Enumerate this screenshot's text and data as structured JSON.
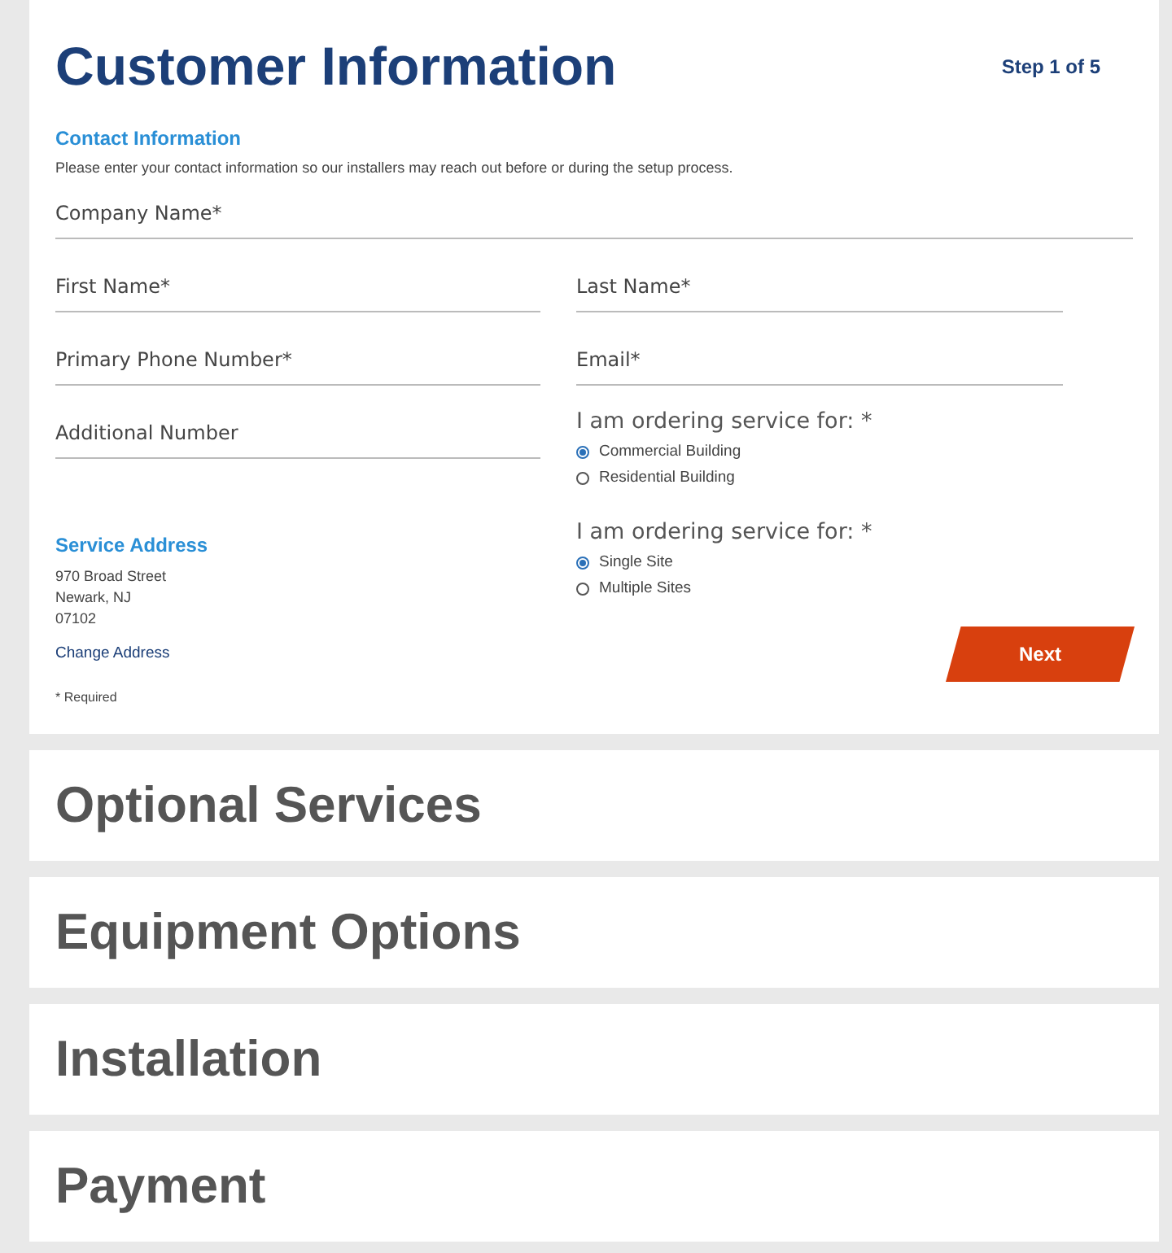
{
  "customer_information": {
    "title": "Customer Information",
    "step": "Step 1 of 5",
    "contact_heading": "Contact Information",
    "contact_note": "Please enter your contact information so our installers may reach out before or during the setup process.",
    "company_field": {
      "placeholder": "Company Name*"
    },
    "left_fields": [
      {
        "placeholder": "First Name*"
      },
      {
        "placeholder": "Primary Phone Number*"
      },
      {
        "placeholder": "Additional Number"
      }
    ],
    "right_fields": [
      {
        "placeholder": "Last Name*"
      },
      {
        "placeholder": "Email*"
      }
    ],
    "radio_groups": [
      {
        "label": "I am ordering service for: *",
        "options": [
          {
            "label": "Commercial Building",
            "selected": true
          },
          {
            "label": "Residential Building",
            "selected": false
          }
        ]
      },
      {
        "label": "I am ordering service for: *",
        "options": [
          {
            "label": "Single Site",
            "selected": true
          },
          {
            "label": "Multiple Sites",
            "selected": false
          }
        ]
      }
    ],
    "service_address": {
      "heading": "Service Address",
      "lines": [
        "970 Broad Street",
        "Newark, NJ",
        "07102"
      ],
      "change_link": "Change Address"
    },
    "required_note": "* Required",
    "next_button": "Next"
  },
  "collapsed_sections": [
    {
      "title": "Optional Services"
    },
    {
      "title": "Equipment Options"
    },
    {
      "title": "Installation"
    },
    {
      "title": "Payment"
    }
  ]
}
